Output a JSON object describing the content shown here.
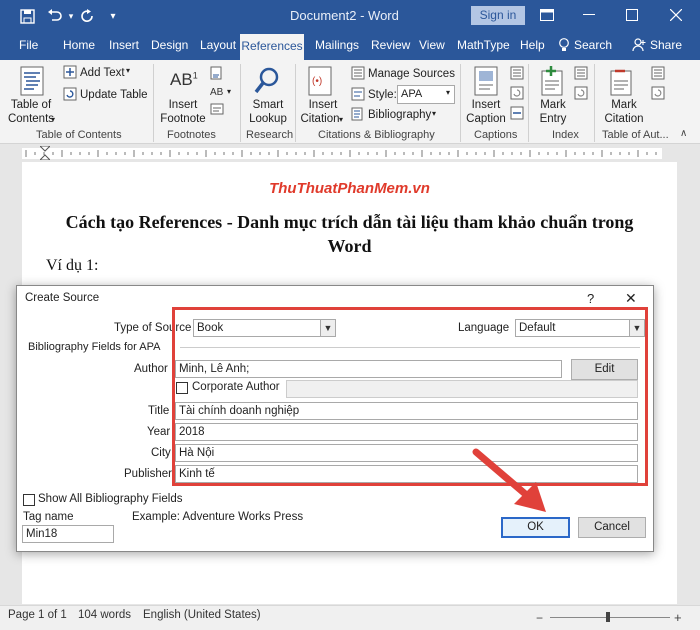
{
  "window": {
    "title": "Document2  -  Word",
    "signin_label": "Sign in"
  },
  "tabs": [
    "File",
    "Home",
    "Insert",
    "Design",
    "Layout",
    "References",
    "Mailings",
    "Review",
    "View",
    "MathType",
    "Help",
    "Search",
    "Share"
  ],
  "ribbon": {
    "toc_label1": "Table of",
    "toc_label2": "Contents",
    "add_text": "Add Text",
    "update_table": "Update Table",
    "group_toc": "Table of Contents",
    "insert_footnote1": "Insert",
    "insert_footnote2": "Footnote",
    "footnote_ab": "AB",
    "footnote_sup": "1",
    "group_footnotes": "Footnotes",
    "smart_lookup1": "Smart",
    "smart_lookup2": "Lookup",
    "group_research": "Research",
    "insert_citation1": "Insert",
    "insert_citation2": "Citation",
    "manage_sources": "Manage Sources",
    "style_label": "Style:",
    "style_value": "APA",
    "bibliography": "Bibliography",
    "group_citations": "Citations & Bibliography",
    "insert_caption1": "Insert",
    "insert_caption2": "Caption",
    "group_captions": "Captions",
    "mark_entry1": "Mark",
    "mark_entry2": "Entry",
    "group_index": "Index",
    "mark_citation1": "Mark",
    "mark_citation2": "Citation",
    "group_toa": "Table of Aut..."
  },
  "document": {
    "watermark": "ThuThuatPhanMem.vn",
    "heading": "Cách tạo References - Danh mục trích dẫn tài liệu tham khảo chuẩn trong Word",
    "example": "Ví dụ 1:"
  },
  "dialog": {
    "title": "Create Source",
    "help": "?",
    "close": "✕",
    "type_label": "Type of Source",
    "type_value": "Book",
    "language_label": "Language",
    "language_value": "Default",
    "section_label": "Bibliography Fields for APA",
    "author_label": "Author",
    "author_value": "Minh, Lê  Anh;",
    "edit_button": "Edit",
    "corporate_label": "Corporate Author",
    "title_label": "Title",
    "title_value": "Tài chính doanh nghiệp",
    "year_label": "Year",
    "year_value": "2018",
    "city_label": "City",
    "city_value": "Hà Nội",
    "publisher_label": "Publisher",
    "publisher_value": "Kinh tế",
    "show_all_label": "Show All Bibliography Fields",
    "tag_label": "Tag name",
    "example_text": "Example: Adventure Works Press",
    "tag_value": "Min18",
    "ok": "OK",
    "cancel": "Cancel"
  },
  "status": {
    "page": "Page 1 of 1",
    "words": "104 words",
    "language": "English (United States)"
  },
  "colors": {
    "title_bar": "#2b579a",
    "highlight_box": "#e0413a",
    "arrow": "#e0413a",
    "ok_border": "#2b68c8"
  }
}
